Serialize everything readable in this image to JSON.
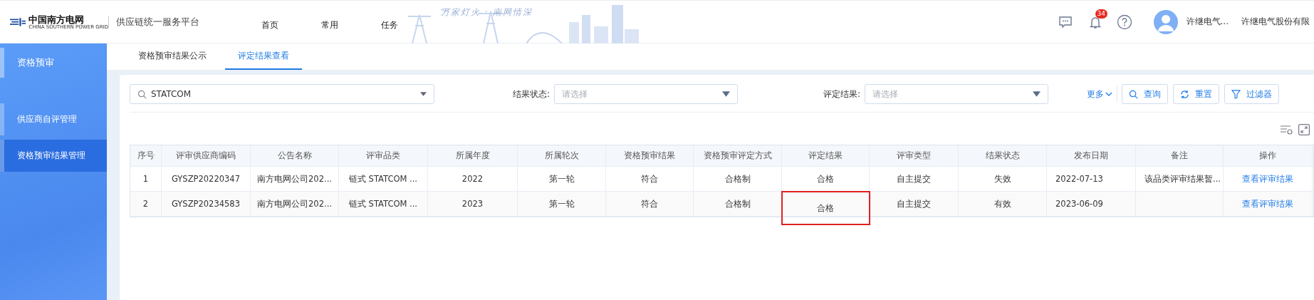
{
  "header": {
    "logo_cn": "中国南方电网",
    "logo_en": "CHINA SOUTHERN POWER GRID",
    "platform": "供应链统一服务平台",
    "nav": [
      {
        "label": "首页"
      },
      {
        "label": "常用"
      },
      {
        "label": "任务"
      }
    ],
    "slogan": "万家灯火 · 南网情深",
    "notifications": "34",
    "user_name": "许继电气...",
    "company": "许继电气股份有限"
  },
  "sidebar": {
    "items": [
      {
        "label": "资格预审",
        "kind": "section",
        "selected": false
      },
      {
        "label": "供应商自评管理",
        "kind": "item",
        "selected": false
      },
      {
        "label": "资格预审结果管理",
        "kind": "item",
        "selected": true
      }
    ]
  },
  "tabs": [
    {
      "label": "资格预审结果公示",
      "selected": false
    },
    {
      "label": "评定结果查看",
      "selected": true
    }
  ],
  "filters": {
    "search_value": "STATCOM",
    "fields": [
      {
        "label": "结果状态:",
        "placeholder": "请选择"
      },
      {
        "label": "评定结果:",
        "placeholder": "请选择"
      }
    ],
    "more": "更多",
    "buttons": [
      "查询",
      "重置",
      "过滤器"
    ]
  },
  "table": {
    "columns": [
      "序号",
      "评审供应商编码",
      "公告名称",
      "评审品类",
      "所属年度",
      "所属轮次",
      "资格预审结果",
      "资格预审评定方式",
      "评定结果",
      "评审类型",
      "结果状态",
      "发布日期",
      "备注",
      "操作"
    ],
    "rows": [
      {
        "cells": [
          "1",
          "GYSZP20220347",
          "南方电网公司202...",
          "链式 STATCOM ...",
          "2022",
          "第一轮",
          "符合",
          "合格制",
          "合格",
          "自主提交",
          "失效",
          "2022-07-13",
          "该品类评审结果暂..."
        ],
        "action": "查看评审结果",
        "result_marked": false
      },
      {
        "cells": [
          "2",
          "GYSZP20234583",
          "南方电网公司202...",
          "链式 STATCOM ...",
          "2023",
          "第一轮",
          "符合",
          "合格制",
          "合格",
          "自主提交",
          "有效",
          "2023-06-09",
          ""
        ],
        "action": "查看评审结果",
        "result_marked": true
      }
    ]
  }
}
